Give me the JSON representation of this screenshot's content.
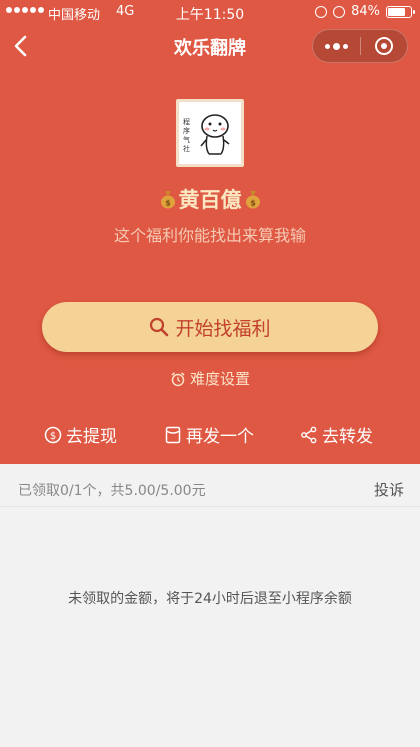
{
  "status_bar": {
    "carrier": "中国移动",
    "network": "4G",
    "time": "上午11:50",
    "battery": "84%",
    "battery_level": 0.84
  },
  "nav": {
    "title": "欢乐翻牌"
  },
  "avatar": {
    "caption": "程序气社"
  },
  "sender": {
    "name": "黄百億",
    "name_icon": "money-bag-icon"
  },
  "subtitle": "这个福利你能找出来算我输",
  "start_button": {
    "label": "开始找福利",
    "icon": "search-icon"
  },
  "difficulty": {
    "label": "难度设置",
    "icon": "alarm-clock-icon"
  },
  "actions": {
    "withdraw": "去提现",
    "send_again": "再发一个",
    "share": "去转发"
  },
  "summary": {
    "claimed_text": "已领取0/1个，共5.00/5.00元",
    "report_label": "投诉"
  },
  "notice": "未领取的金额，将于24小时后退至小程序余额",
  "colors": {
    "primary_red": "#df5843",
    "button_gold": "#f5d396",
    "name_gold": "#fbe8c2",
    "background": "#f2f2f2"
  }
}
